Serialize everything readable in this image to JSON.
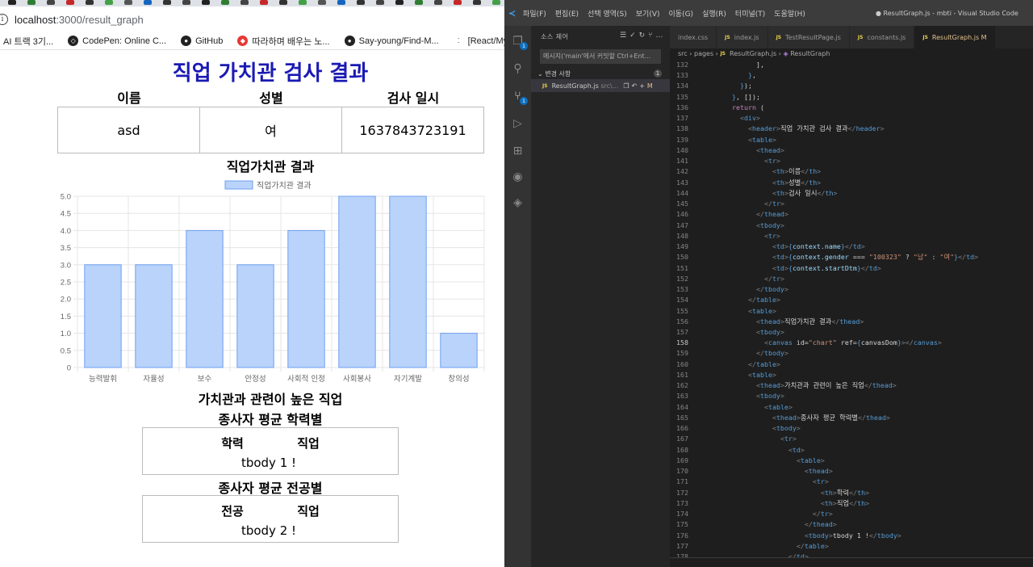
{
  "browser": {
    "url_host": "localhost",
    "url_path": ":3000/result_graph",
    "bookmarks": [
      {
        "icon": "ai-icon",
        "label": "AI 트랙 3기..."
      },
      {
        "icon": "codepen-icon",
        "label": "CodePen: Online C..."
      },
      {
        "icon": "github-icon",
        "label": "GitHub"
      },
      {
        "icon": "bookmark-icon",
        "label": "따라하며 배우는 노..."
      },
      {
        "icon": "github-icon",
        "label": "Say-young/Find-M..."
      },
      {
        "icon": "dots-icon",
        "label": "[React/MySQL] re"
      }
    ]
  },
  "page": {
    "title": "직업 가치관 검사 결과",
    "info_headers": [
      "이름",
      "성별",
      "검사 일시"
    ],
    "info_values": [
      "asd",
      "여",
      "1637843723191"
    ],
    "chart_title": "직업가치관 결과",
    "section2_title": "가치관과 관련이 높은 직업",
    "table1_title": "종사자 평균 학력별",
    "table1_headers": [
      "학력",
      "직업"
    ],
    "table1_body": "tbody 1 !",
    "table2_title": "종사자 평균 전공별",
    "table2_headers": [
      "전공",
      "직업"
    ],
    "table2_body": "tbody 2 !"
  },
  "chart_data": {
    "type": "bar",
    "categories": [
      "능력발휘",
      "자율성",
      "보수",
      "안정성",
      "사회적 인정",
      "사회봉사",
      "자기계발",
      "창의성"
    ],
    "series": [
      {
        "name": "직업가치관 결과",
        "values": [
          3,
          3,
          4,
          3,
          4,
          5,
          5,
          1
        ]
      }
    ],
    "ylim": [
      0,
      5
    ],
    "yticks": [
      "0",
      "0.5",
      "1.0",
      "1.5",
      "2.0",
      "2.5",
      "3.0",
      "3.5",
      "4.0",
      "4.5",
      "5.0"
    ],
    "legend": "top-center",
    "bar_color": "#b9d3fb",
    "bar_border": "#6e9ff0"
  },
  "vscode": {
    "menu": [
      "파일(F)",
      "편집(E)",
      "선택 영역(S)",
      "보기(V)",
      "이동(G)",
      "실행(R)",
      "터미널(T)",
      "도움말(H)"
    ],
    "window_title": "● ResultGraph.js - mbti - Visual Studio Code",
    "sidebar_title": "소스 제어",
    "commit_placeholder": "메시지('main'에서 커밋할 Ctrl+Ent...",
    "changes_label": "변경 사항",
    "changes_count": "1",
    "changed_file": "ResultGraph.js",
    "changed_file_path": "src\\...",
    "changed_file_status": "M",
    "tabs": [
      "index.css",
      "index.js",
      "TestResultPage.js",
      "constants.js",
      "ResultGraph.js"
    ],
    "active_tab_status": "M",
    "breadcrumb": [
      "src",
      "pages",
      "ResultGraph.js",
      "ResultGraph"
    ],
    "activity_badge": "1",
    "code": [
      {
        "n": "132",
        "t": "          ],"
      },
      {
        "n": "133",
        "t": "        },"
      },
      {
        "n": "134",
        "t": "      });"
      },
      {
        "n": "135",
        "t": "    }, []);"
      },
      {
        "n": "136",
        "t": "    return ("
      },
      {
        "n": "137",
        "t": "      <div>"
      },
      {
        "n": "138",
        "t": "        <header>직업 가치관 검사 결과</header>"
      },
      {
        "n": "139",
        "t": "        <table>"
      },
      {
        "n": "140",
        "t": "          <thead>"
      },
      {
        "n": "141",
        "t": "            <tr>"
      },
      {
        "n": "142",
        "t": "              <th>이름</th>"
      },
      {
        "n": "143",
        "t": "              <th>성별</th>"
      },
      {
        "n": "144",
        "t": "              <th>검사 일시</th>"
      },
      {
        "n": "145",
        "t": "            </tr>"
      },
      {
        "n": "146",
        "t": "          </thead>"
      },
      {
        "n": "147",
        "t": "          <tbody>"
      },
      {
        "n": "148",
        "t": "            <tr>"
      },
      {
        "n": "149",
        "t": "              <td>{context.name}</td>"
      },
      {
        "n": "150",
        "t": "              <td>{context.gender === \"100323\" ? \"남\" : \"여\"}</td>"
      },
      {
        "n": "151",
        "t": "              <td>{context.startDtm}</td>"
      },
      {
        "n": "152",
        "t": "            </tr>"
      },
      {
        "n": "153",
        "t": "          </tbody>"
      },
      {
        "n": "154",
        "t": "        </table>"
      },
      {
        "n": "155",
        "t": "        <table>"
      },
      {
        "n": "156",
        "t": "          <thead>직업가치관 결과</thead>"
      },
      {
        "n": "157",
        "t": "          <tbody>"
      },
      {
        "n": "158",
        "t": "            <canvas id=\"chart\" ref={canvasDom}></canvas>"
      },
      {
        "n": "159",
        "t": "          </tbody>"
      },
      {
        "n": "160",
        "t": "        </table>"
      },
      {
        "n": "161",
        "t": "        <table>"
      },
      {
        "n": "162",
        "t": "          <thead>가치관과 관련이 높은 직업</thead>"
      },
      {
        "n": "163",
        "t": "          <tbody>"
      },
      {
        "n": "164",
        "t": "            <table>"
      },
      {
        "n": "165",
        "t": "              <thead>종사자 평균 학력별</thead>"
      },
      {
        "n": "166",
        "t": "              <tbody>"
      },
      {
        "n": "167",
        "t": "                <tr>"
      },
      {
        "n": "168",
        "t": "                  <td>"
      },
      {
        "n": "169",
        "t": "                    <table>"
      },
      {
        "n": "170",
        "t": "                      <thead>"
      },
      {
        "n": "171",
        "t": "                        <tr>"
      },
      {
        "n": "172",
        "t": "                          <th>학력</th>"
      },
      {
        "n": "173",
        "t": "                          <th>직업</th>"
      },
      {
        "n": "174",
        "t": "                        </tr>"
      },
      {
        "n": "175",
        "t": "                      </thead>"
      },
      {
        "n": "176",
        "t": "                      <tbody>tbody 1 !</tbody>"
      },
      {
        "n": "177",
        "t": "                    </table>"
      },
      {
        "n": "178",
        "t": "                  </td>"
      }
    ],
    "current_line": "158"
  }
}
